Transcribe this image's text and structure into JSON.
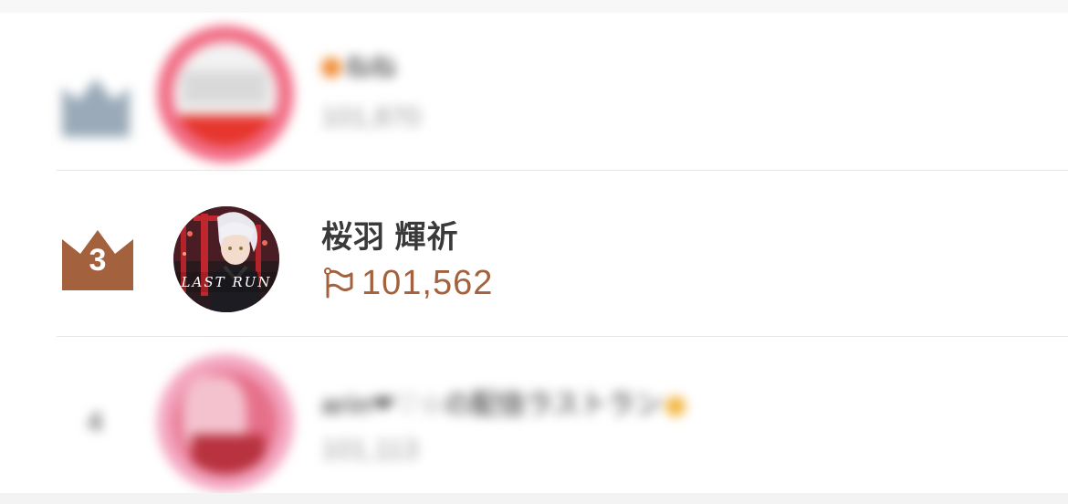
{
  "ranking": {
    "entries": [
      {
        "rank": "2",
        "name": "ねね",
        "score": "101,870"
      },
      {
        "rank": "3",
        "name": "桜羽 輝祈",
        "score": "101,562",
        "avatar_text": "LAST RUN"
      },
      {
        "rank": "4",
        "name": "arin❤︎♡☆の配信ラストラン",
        "score": "101,113"
      }
    ]
  },
  "colors": {
    "bronze": "#a4613d",
    "silver": "#9aaab8",
    "divider": "#e6e6e6"
  },
  "icons": {
    "rank3": "crown-icon",
    "score": "flag-icon"
  }
}
